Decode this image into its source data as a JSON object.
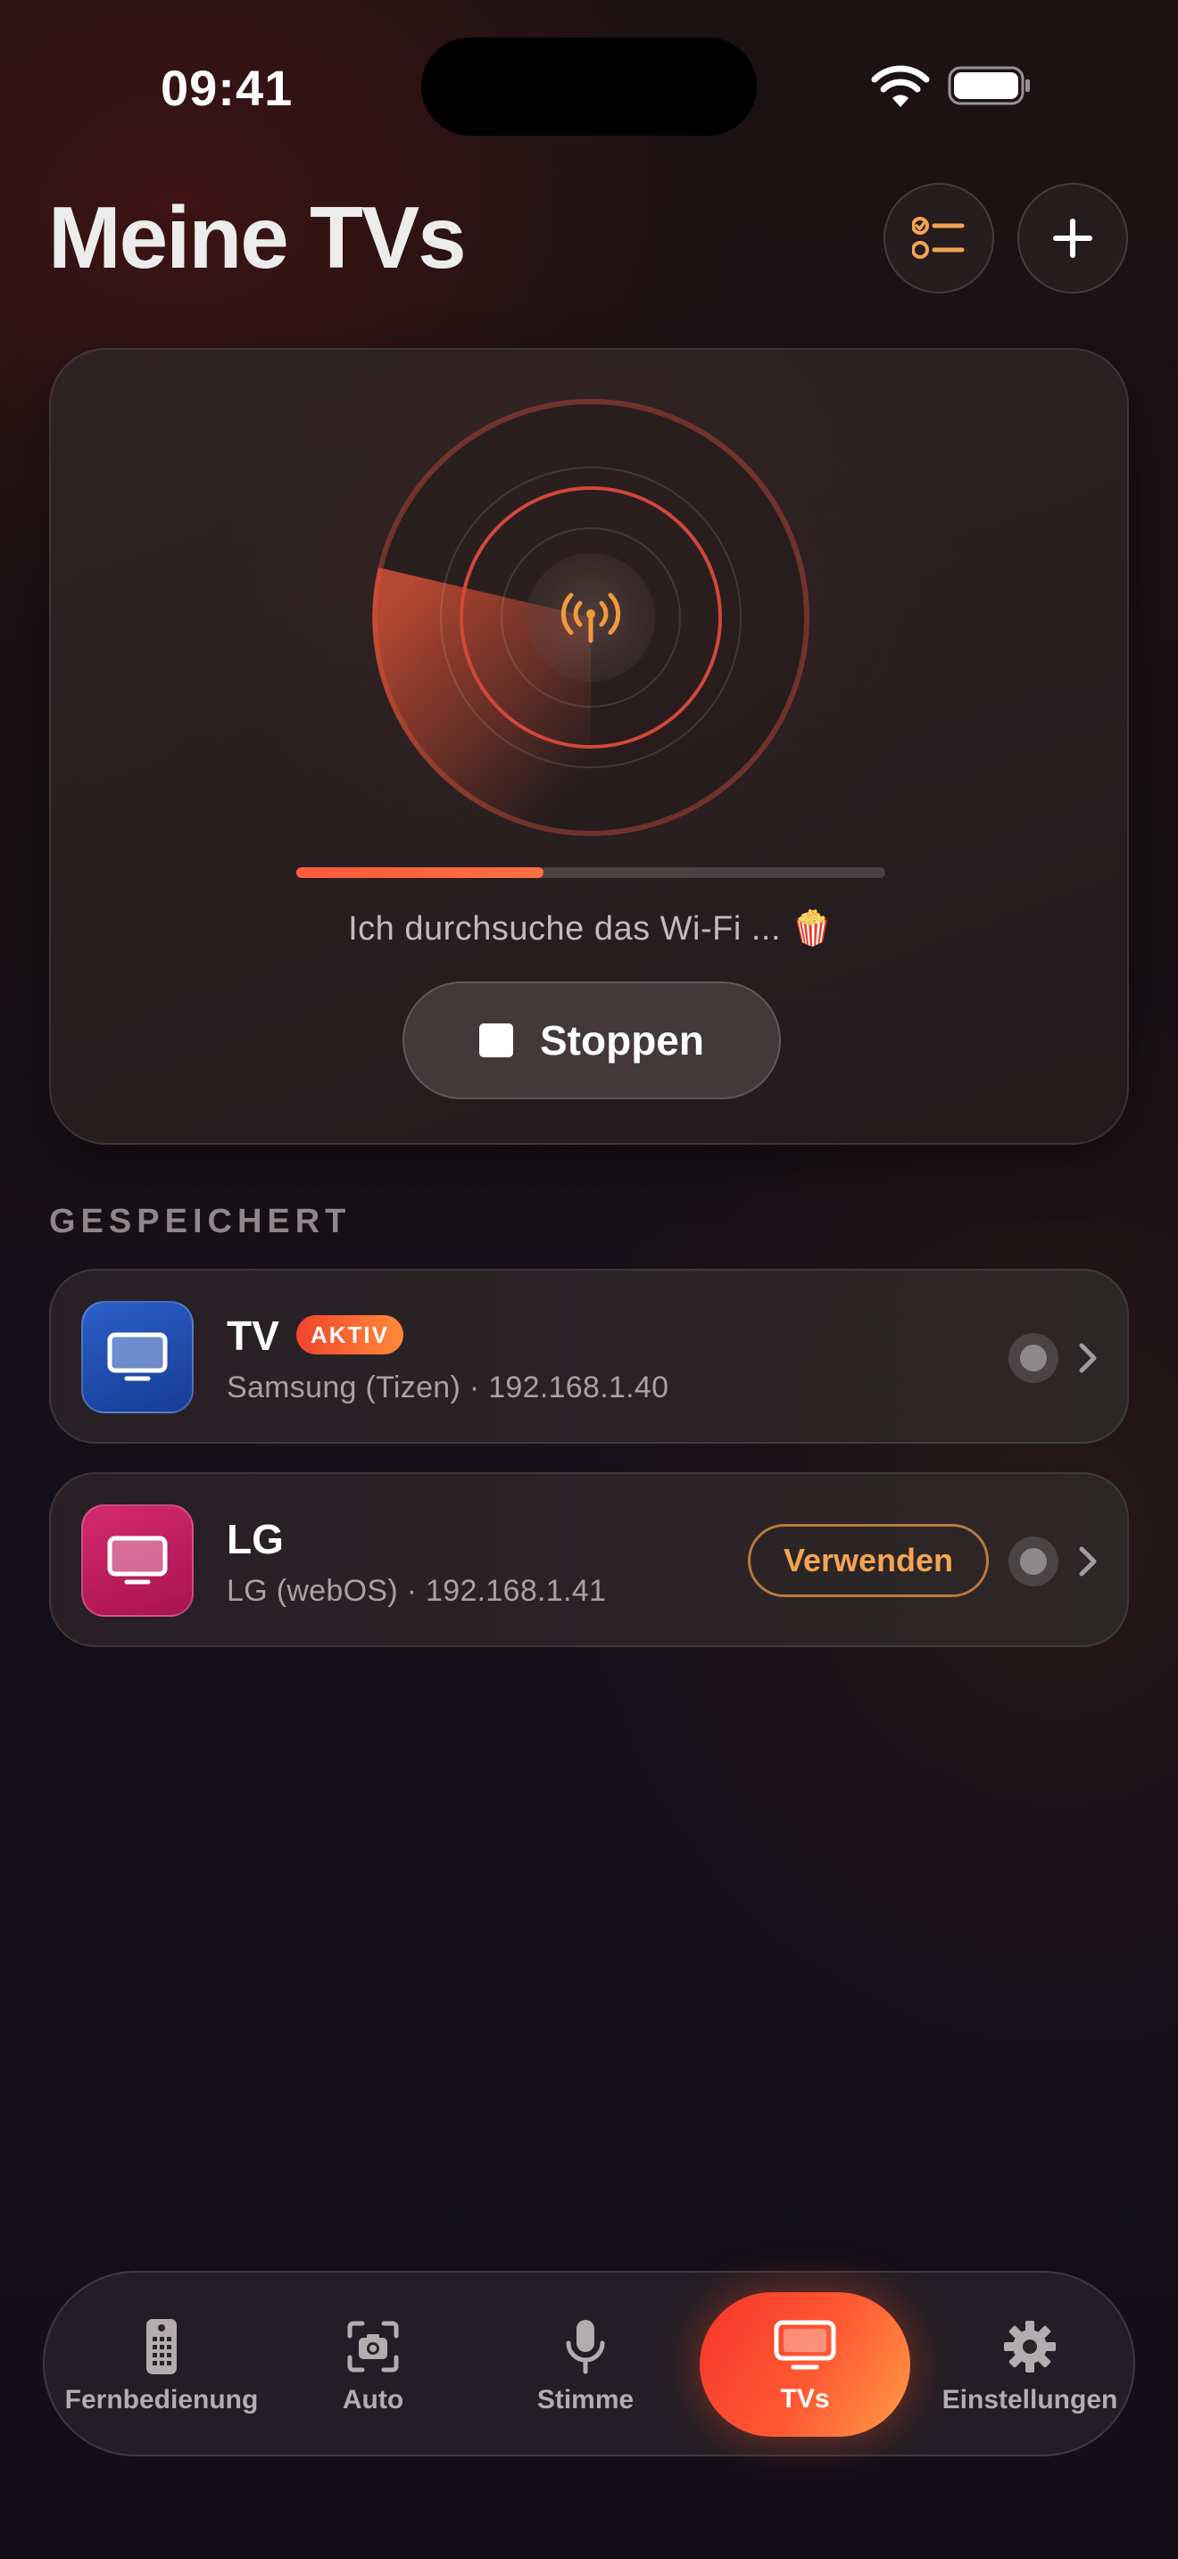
{
  "status_bar": {
    "time": "09:41"
  },
  "header": {
    "title": "Meine TVs"
  },
  "scan": {
    "progress_fraction": 0.42,
    "status_text": "Ich durchsuche das Wi-Fi ... 🍿",
    "stop_label": "Stoppen"
  },
  "saved": {
    "section_label": "GESPEICHERT",
    "devices": [
      {
        "name": "TV",
        "badge": "AKTIV",
        "meta": "Samsung (Tizen) · 192.168.1.40",
        "icon": "tv-icon"
      },
      {
        "name": "LG",
        "meta": "LG (webOS) · 192.168.1.41",
        "use_label": "Verwenden",
        "icon": "tv-icon"
      }
    ]
  },
  "tabs": [
    {
      "label": "Fernbedienung",
      "icon": "remote-icon"
    },
    {
      "label": "Auto",
      "icon": "camera-scan-icon"
    },
    {
      "label": "Stimme",
      "icon": "microphone-icon"
    },
    {
      "label": "TVs",
      "icon": "tv-icon",
      "active": true
    },
    {
      "label": "Einstellungen",
      "icon": "gear-icon"
    }
  ],
  "colors": {
    "accent": "#ff5a3c",
    "accent_orange": "#f3a452",
    "samsung_tile": "#2c5fc8",
    "lg_tile": "#d42a6e"
  }
}
